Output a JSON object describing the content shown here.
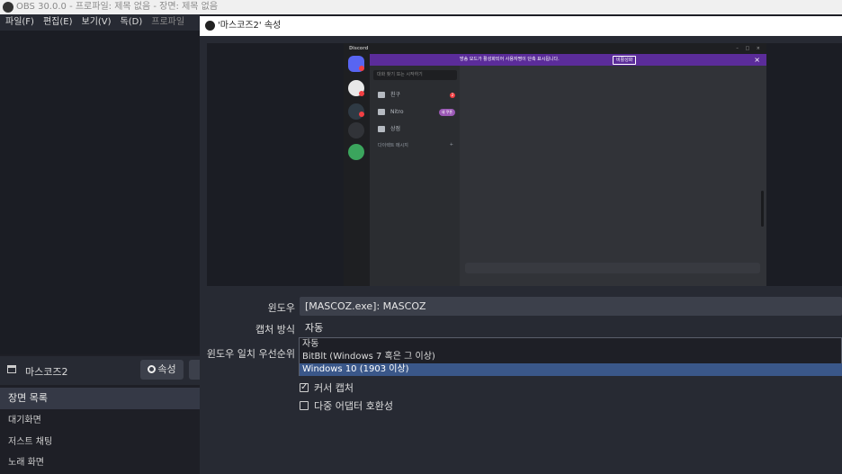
{
  "window_title": "OBS 30.0.0 - 프로파일: 제목 없음 - 장면: 제목 없음",
  "menu": [
    {
      "label": "파일(F)",
      "dim": false
    },
    {
      "label": "편집(E)",
      "dim": false
    },
    {
      "label": "보기(V)",
      "dim": false
    },
    {
      "label": "독(D)",
      "dim": false
    },
    {
      "label": "프로파일(P)",
      "dim": true
    }
  ],
  "source": {
    "name": "마스코즈2",
    "properties_label": "속성"
  },
  "scenes": {
    "header": "장면 목록",
    "items": [
      "대기화면",
      "저스트 채팅",
      "노래 화면"
    ]
  },
  "dialog": {
    "title": "'마스코즈2' 속성",
    "fields": {
      "window_label": "윈도우",
      "window_value": "[MASCOZ.exe]: MASCOZ",
      "capture_label": "캡처 방식",
      "capture_value": "자동",
      "priority_label": "윈도우 일치 우선순위"
    },
    "dropdown_options": [
      {
        "label": "자동",
        "selected": false
      },
      {
        "label": "BitBlt (Windows 7 혹은 그 이상)",
        "selected": false
      },
      {
        "label": "Windows 10 (1903 이상)",
        "selected": true
      }
    ],
    "checkboxes": [
      {
        "label": "커서 캡처",
        "checked": true
      },
      {
        "label": "다중 어댑터 호환성",
        "checked": false
      }
    ]
  },
  "discord": {
    "brand": "Discord",
    "window_controls": "– □ ×",
    "banner_text": "방송 모드가 활성화되어 사용자명이 단축 표시됩니다.",
    "banner_button": "비활성화",
    "banner_close": "×",
    "search_placeholder": "대화 찾기 또는 시작하기",
    "nav": [
      {
        "label": "친구",
        "badge": "2"
      },
      {
        "label": "Nitro",
        "badge": "새 쿠폰"
      },
      {
        "label": "상점",
        "badge": ""
      }
    ],
    "dm_header": "다이렉트 메시지",
    "dm_add": "+"
  },
  "colors": {
    "accent_selected": "#3a5789",
    "discord_purple": "#5b2c9a",
    "discord_blurple": "#5865f2",
    "discord_red": "#f23f43"
  }
}
